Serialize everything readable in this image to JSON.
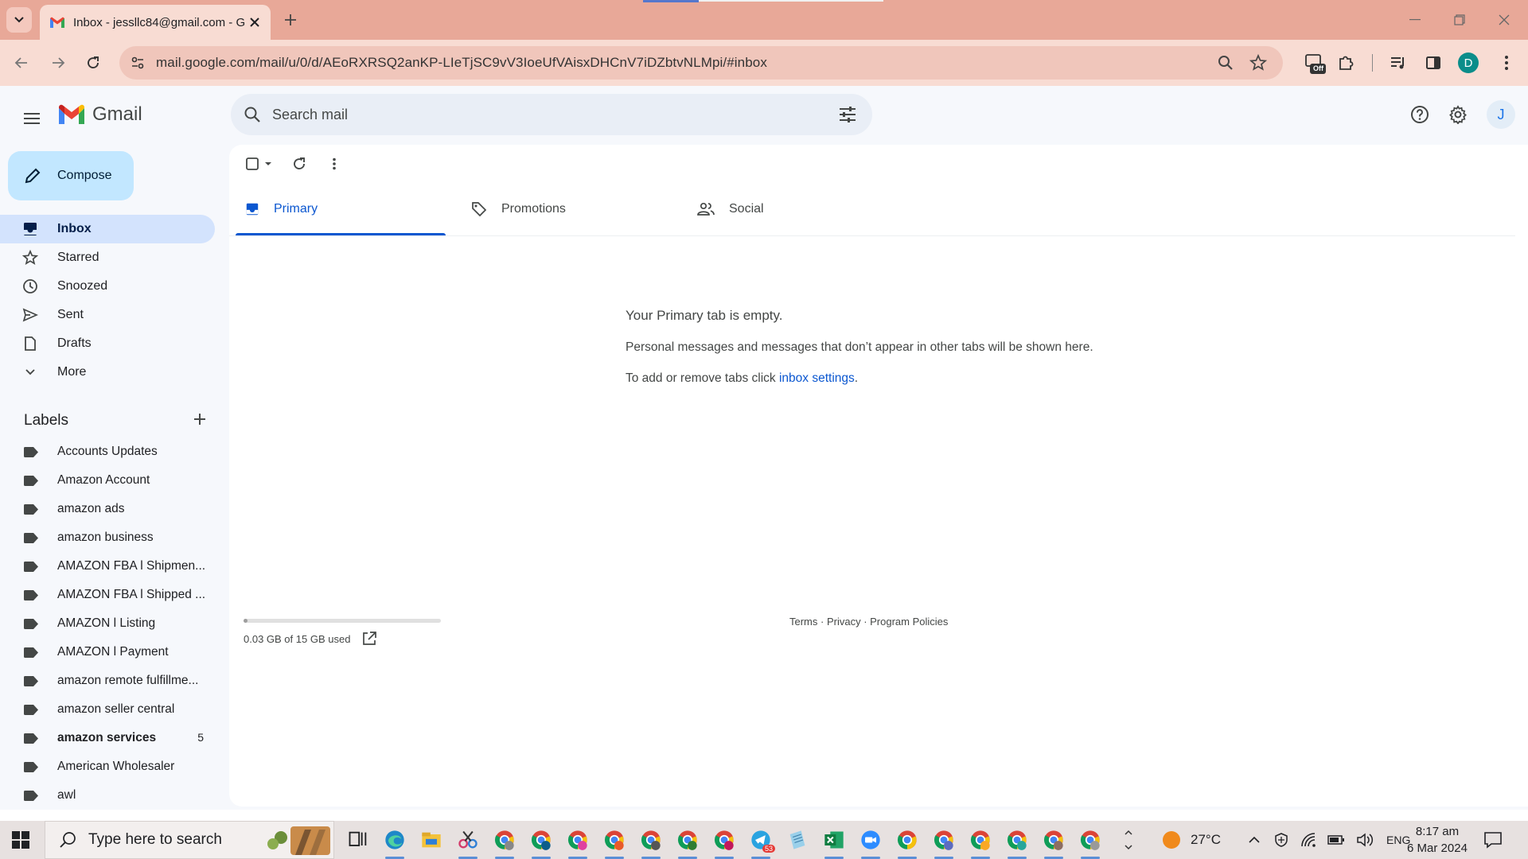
{
  "browser": {
    "tab_title": "Inbox - jessllc84@gmail.com - G",
    "url": "mail.google.com/mail/u/0/d/AEoRXRSQ2anKP-LIeTjSC9vV3IoeUfVAisxDHCnV7iDZbtvNLMpi/#inbox",
    "profile_letter": "D",
    "extension_badge": "Off"
  },
  "gmail": {
    "app_name": "Gmail",
    "search_placeholder": "Search mail",
    "compose_label": "Compose",
    "avatar_letter": "J",
    "nav": [
      {
        "label": "Inbox",
        "icon": "inbox-icon",
        "active": true
      },
      {
        "label": "Starred",
        "icon": "star-icon"
      },
      {
        "label": "Snoozed",
        "icon": "clock-icon"
      },
      {
        "label": "Sent",
        "icon": "send-icon"
      },
      {
        "label": "Drafts",
        "icon": "draft-icon"
      },
      {
        "label": "More",
        "icon": "chevron-down-icon"
      }
    ],
    "labels_heading": "Labels",
    "labels": [
      {
        "name": "Accounts Updates"
      },
      {
        "name": "Amazon Account"
      },
      {
        "name": "amazon ads"
      },
      {
        "name": "amazon business"
      },
      {
        "name": "AMAZON FBA l Shipmen..."
      },
      {
        "name": "AMAZON FBA l Shipped ..."
      },
      {
        "name": "AMAZON l Listing"
      },
      {
        "name": "AMAZON l Payment"
      },
      {
        "name": "amazon remote fulfillme..."
      },
      {
        "name": "amazon seller central"
      },
      {
        "name": "amazon services",
        "count": "5",
        "bold": true
      },
      {
        "name": "American Wholesaler"
      },
      {
        "name": "awl"
      }
    ],
    "tabs": [
      {
        "label": "Primary",
        "icon": "inbox-icon",
        "active": true
      },
      {
        "label": "Promotions",
        "icon": "tag-icon"
      },
      {
        "label": "Social",
        "icon": "people-icon"
      }
    ],
    "empty": {
      "title": "Your Primary tab is empty.",
      "description": "Personal messages and messages that don’t appear in other tabs will be shown here.",
      "settings_prefix": "To add or remove tabs click ",
      "settings_link": "inbox settings",
      "settings_suffix": "."
    },
    "storage": {
      "text": "0.03 GB of 15 GB used",
      "fraction_used": 0.002
    },
    "footer": {
      "terms": "Terms",
      "privacy": "Privacy",
      "policies": "Program Policies",
      "separator": " · "
    },
    "colors": {
      "accent": "#0b57d0",
      "compose_bg": "#c2e7ff",
      "active_nav_bg": "#d3e3fd"
    }
  },
  "taskbar": {
    "search_placeholder": "Type here to search",
    "weather": "27°C",
    "language": "ENG",
    "time": "8:17 am",
    "date": "6 Mar 2024",
    "telegram_badge": "53"
  }
}
